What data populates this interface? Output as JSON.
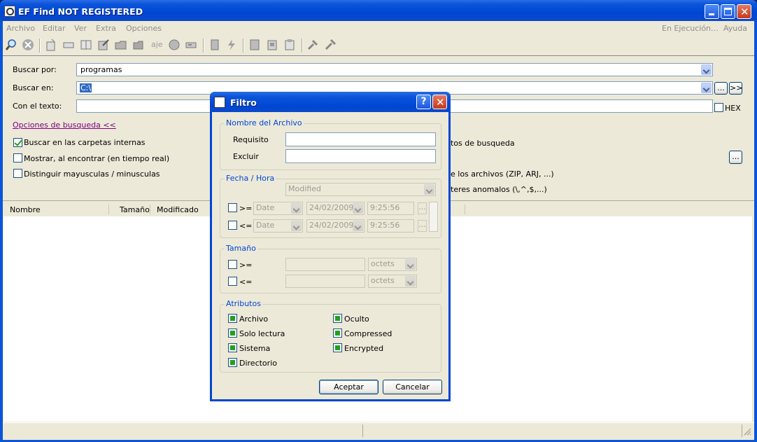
{
  "window": {
    "title": "EF Find NOT REGISTERED"
  },
  "menu": {
    "items": [
      "Archivo",
      "Editar",
      "Ver",
      "Extra",
      "Opciones"
    ],
    "right": [
      "En Ejecución…",
      "Ayuda"
    ]
  },
  "toolbar": {
    "icons": [
      "search-icon",
      "stop-icon",
      "new-icon",
      "rename-icon",
      "view-icon",
      "edit-icon",
      "open-icon",
      "copy-icon",
      "encode-icon",
      "move-icon",
      "print-icon",
      "list-icon",
      "lightning-icon",
      "save-icon",
      "saveas-icon",
      "clipboard-icon",
      "settings-icon",
      "tools-icon"
    ]
  },
  "search": {
    "buscar_por_label": "Buscar por:",
    "buscar_por_value": "programas",
    "buscar_en_label": "Buscar en:",
    "buscar_en_value": "C:\\",
    "con_texto_label": "Con el texto:",
    "con_texto_value": "",
    "browse_btn": "...",
    "more_btn": ">>",
    "hex_label": "HEX",
    "options_link": "Opciones de busqueda  <<"
  },
  "options": {
    "subfolders": "Buscar en las carpetas internas",
    "realtime": "Mostrar, al encontrar (en tiempo real)",
    "case": "Distinguir mayusculas / minusculas",
    "right1": "tos de busqueda",
    "right2": "e los archivos (ZIP, ARJ, ...)",
    "right3": "teres anomalos (\\,^,$,...)",
    "right_btn": "..."
  },
  "list": {
    "columns": [
      "Nombre",
      "Tamaño",
      "Modificado"
    ]
  },
  "dialog": {
    "title": "Filtro",
    "help_btn": "?",
    "nombre": {
      "group": "Nombre del Archivo",
      "requisito": "Requisito",
      "excluir": "Excluir",
      "requisito_value": "",
      "excluir_value": ""
    },
    "fecha": {
      "group": "Fecha / Hora",
      "type": "Modified",
      "row1": {
        "op": ">=",
        "kind": "Date",
        "date": "24/02/2009",
        "time": "9:25:56"
      },
      "row2": {
        "op": "<=",
        "kind": "Date",
        "date": "24/02/2009",
        "time": "9:25:56"
      },
      "dots": "..."
    },
    "tamano": {
      "group": "Tamaño",
      "row1": {
        "op": ">=",
        "unit": "octets"
      },
      "row2": {
        "op": "<=",
        "unit": "octets"
      }
    },
    "atributos": {
      "group": "Atributos",
      "items": [
        "Archivo",
        "Solo lectura",
        "Sistema",
        "Directorio",
        "Oculto",
        "Compressed",
        "Encrypted"
      ]
    },
    "ok": "Aceptar",
    "cancel": "Cancelar"
  }
}
